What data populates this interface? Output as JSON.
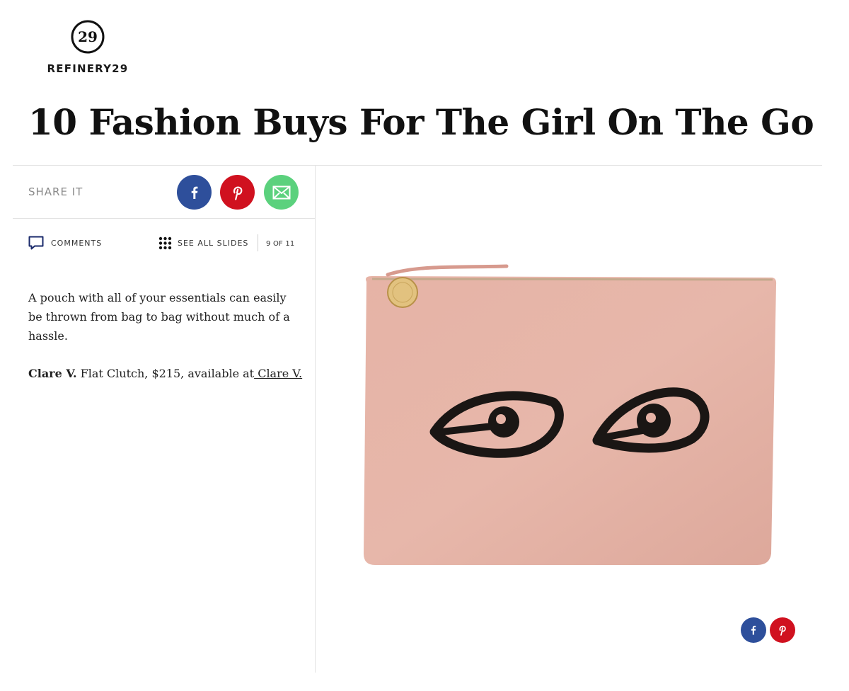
{
  "brand": {
    "mark_text": "29",
    "name": "REFINERY29"
  },
  "article": {
    "title": "10 Fashion Buys For The Girl On The Go"
  },
  "share": {
    "label": "SHARE IT",
    "buttons": [
      {
        "icon": "facebook-icon",
        "color": "#2e4f9b"
      },
      {
        "icon": "pinterest-icon",
        "color": "#d0111f"
      },
      {
        "icon": "mail-icon",
        "color": "#5bd17d"
      }
    ]
  },
  "toolbar": {
    "comments_label": "COMMENTS",
    "see_all_label": "SEE ALL SLIDES",
    "slide_counter": "9 OF 11"
  },
  "slide": {
    "description": "A pouch with all of your essentials can easily be thrown from bag to bag without much of a hassle.",
    "brand_name": "Clare V.",
    "product_text": " Flat Clutch, $215, available at",
    "retailer_link": " Clare V.",
    "product_color": "#e6b3a6"
  },
  "image_share": {
    "buttons": [
      {
        "icon": "facebook-icon",
        "color": "#2e4f9b"
      },
      {
        "icon": "pinterest-icon",
        "color": "#d0111f"
      }
    ]
  }
}
